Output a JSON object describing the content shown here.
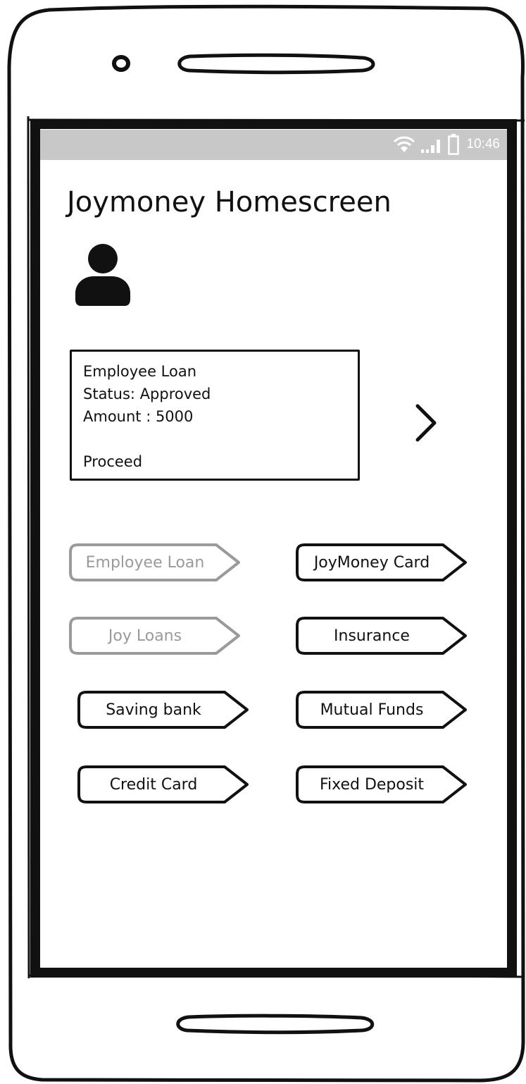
{
  "status_bar": {
    "time": "10:46",
    "icons": [
      "wifi-icon",
      "signal-icon",
      "battery-icon"
    ]
  },
  "page": {
    "title": "Joymoney Homescreen"
  },
  "loan_card": {
    "line1": "Employee Loan",
    "line2": "Status: Approved",
    "line3": "Amount : 5000",
    "line4": "Proceed"
  },
  "buttons": [
    {
      "label": "Employee Loan",
      "enabled": false
    },
    {
      "label": "JoyMoney Card",
      "enabled": true
    },
    {
      "label": "Joy Loans",
      "enabled": false
    },
    {
      "label": "Insurance",
      "enabled": true
    },
    {
      "label": "Saving bank",
      "enabled": true
    },
    {
      "label": "Mutual Funds",
      "enabled": true
    },
    {
      "label": "Credit Card",
      "enabled": true
    },
    {
      "label": "Fixed Deposit",
      "enabled": true
    }
  ],
  "colors": {
    "ink": "#111111",
    "disabled": "#9a9a9a",
    "status_bar": "#c8c8c8"
  }
}
